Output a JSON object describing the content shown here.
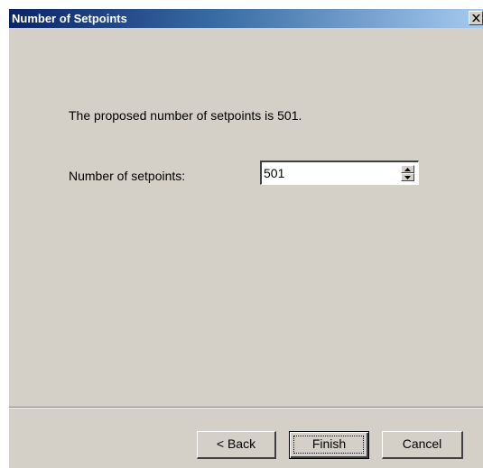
{
  "dialog": {
    "title": "Number of Setpoints",
    "close_icon": "close-icon",
    "message": "The proposed number of setpoints is 501.",
    "setpoints_label": "Number of setpoints:",
    "setpoints_value": "501",
    "spin_up_icon": "arrow-up-icon",
    "spin_down_icon": "arrow-down-icon"
  },
  "buttons": {
    "back": "< Back",
    "finish": "Finish",
    "cancel": "Cancel"
  },
  "colors": {
    "title_gradient_start": "#0a246a",
    "title_gradient_end": "#a6caf0",
    "dialog_face": "#d4d0c8"
  }
}
